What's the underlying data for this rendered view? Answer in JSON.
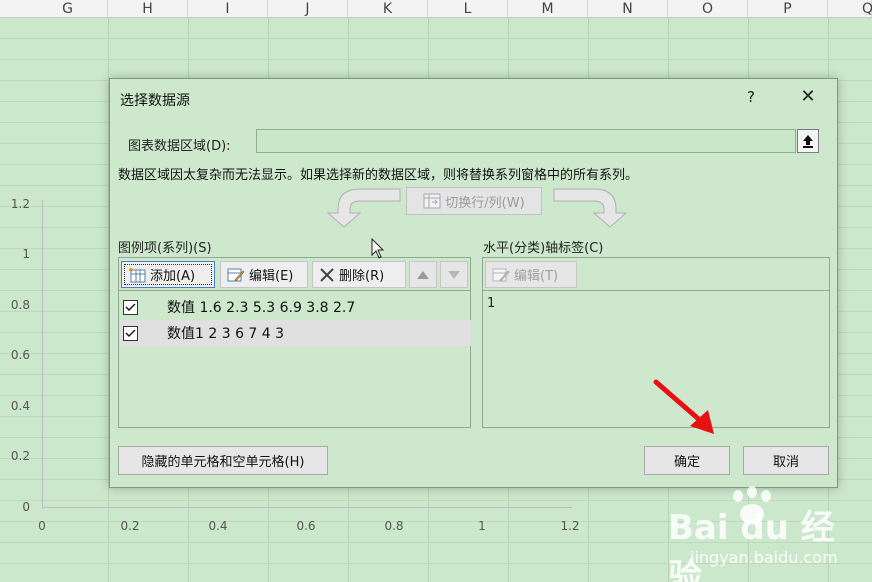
{
  "spreadsheet": {
    "columns": [
      "G",
      "H",
      "I",
      "J",
      "K",
      "L",
      "M",
      "N",
      "O",
      "P",
      "Q"
    ],
    "chart": {
      "y_ticks": [
        "1.2",
        "1",
        "0.8",
        "0.6",
        "0.4",
        "0.2",
        "0"
      ],
      "x_ticks": [
        "0",
        "0.2",
        "0.4",
        "0.6",
        "0.8",
        "1",
        "1.2"
      ]
    }
  },
  "dialog": {
    "title": "选择数据源",
    "help": "?",
    "close": "✕",
    "range_label": "图表数据区域(D):",
    "range_value": "",
    "warning": "数据区域因太复杂而无法显示。如果选择新的数据区域，则将替换系列窗格中的所有系列。",
    "switch_label": "切换行/列(W)",
    "legend_label": "图例项(系列)(S)",
    "axis_label": "水平(分类)轴标签(C)",
    "legend_toolbar": {
      "add": "添加(A)",
      "edit": "编辑(E)",
      "delete": "删除(R)"
    },
    "series": [
      {
        "name": "数值 1.6 2.3 5.3 6.9 3.8 2.7",
        "checked": true,
        "selected": false
      },
      {
        "name": "数值1 2 3 6 7 4 3",
        "checked": true,
        "selected": true
      }
    ],
    "axis_toolbar": {
      "edit": "编辑(T)"
    },
    "axis_values": [
      "1"
    ],
    "buttons": {
      "hidden_cells": "隐藏的单元格和空单元格(H)",
      "ok": "确定",
      "cancel": "取消"
    }
  },
  "watermark": {
    "brand": "Bai du 经验",
    "site": "jingyan.baidu.com"
  },
  "colors": {
    "background": "#cce8cc",
    "annotation_arrow": "#e81010"
  }
}
